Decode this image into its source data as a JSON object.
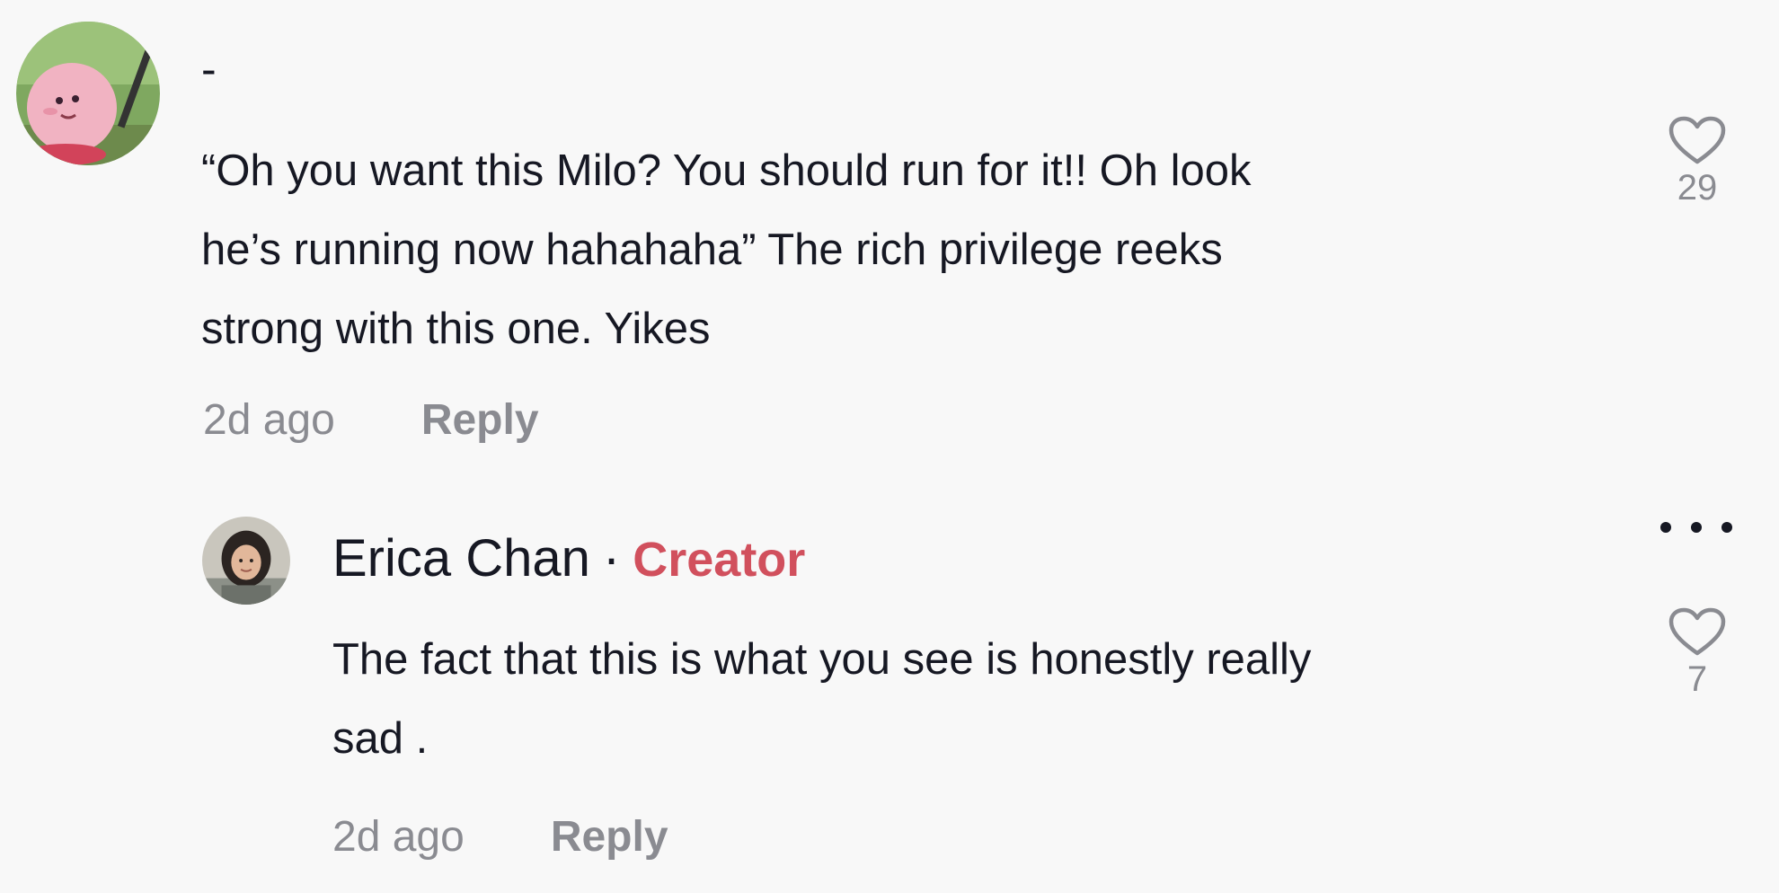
{
  "comment": {
    "username": "-",
    "avatar": "kirby-avatar",
    "text": "“Oh you want this Milo? You should run for it!! Oh look\nhe’s running now hahahaha” The rich privilege reeks\nstrong with this one. Yikes",
    "time": "2d ago",
    "reply_label": "Reply",
    "likes": "29",
    "like_icon": "heart-outline-icon"
  },
  "reply": {
    "username": "Erica Chan",
    "separator": "·",
    "badge": "Creator",
    "avatar": "user-photo-avatar",
    "text": "The fact that this is what you see is honestly really\nsad .",
    "time": "2d ago",
    "reply_label": "Reply",
    "likes": "7",
    "like_icon": "heart-outline-icon",
    "more_icon": "more-dots-icon"
  },
  "colors": {
    "background": "#f8f8f8",
    "text": "#161823",
    "muted": "#8a8b91",
    "creator_badge": "#d1505d"
  }
}
